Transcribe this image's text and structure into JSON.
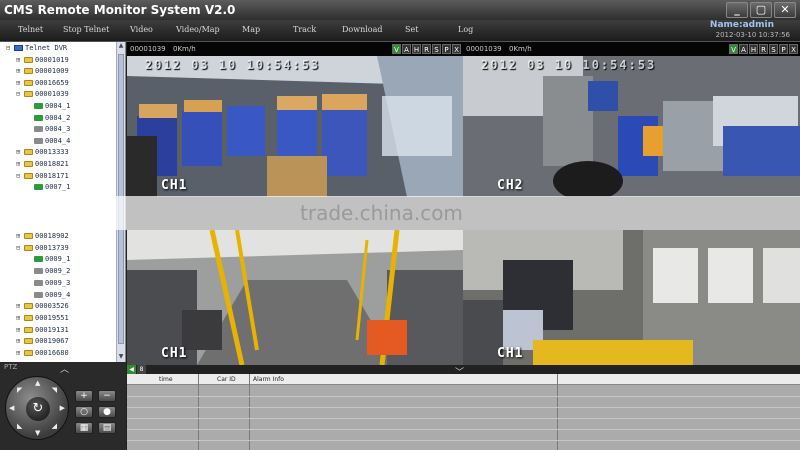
{
  "window": {
    "title": "CMS Remote Monitor System V2.0",
    "controls": [
      "_",
      "▢",
      "✕"
    ]
  },
  "menu": {
    "items": [
      "Telnet",
      "Stop Telnet",
      "Video",
      "Video/Map",
      "Map",
      "Track",
      "Download",
      "Set",
      "Log"
    ]
  },
  "user": {
    "label": "Name:admin",
    "datetime": "2012-03-10 10:37:56"
  },
  "tree": {
    "items": [
      {
        "toggle": "⊟",
        "icon": "root",
        "label": "Telnet DVR"
      },
      {
        "toggle": "⊞",
        "icon": "bus",
        "label": "00001019"
      },
      {
        "toggle": "⊞",
        "icon": "bus",
        "label": "00001009"
      },
      {
        "toggle": "⊞",
        "icon": "bus",
        "label": "00016659"
      },
      {
        "toggle": "⊟",
        "icon": "bus",
        "label": "00001039"
      },
      {
        "toggle": "",
        "icon": "cam",
        "label": "0004_1"
      },
      {
        "toggle": "",
        "icon": "cam",
        "label": "0004_2"
      },
      {
        "toggle": "",
        "icon": "cam-off",
        "label": "0004_3"
      },
      {
        "toggle": "",
        "icon": "cam-off",
        "label": "0004_4"
      },
      {
        "toggle": "⊞",
        "icon": "bus",
        "label": "00013333"
      },
      {
        "toggle": "⊞",
        "icon": "bus",
        "label": "00018821"
      },
      {
        "toggle": "⊟",
        "icon": "bus",
        "label": "00018171"
      },
      {
        "toggle": "",
        "icon": "cam",
        "label": "0007_1"
      },
      {
        "toggle": "⊞",
        "icon": "bus",
        "label": "00018902"
      },
      {
        "toggle": "⊟",
        "icon": "bus",
        "label": "00013739"
      },
      {
        "toggle": "",
        "icon": "cam",
        "label": "0009_1"
      },
      {
        "toggle": "",
        "icon": "cam-off",
        "label": "0009_2"
      },
      {
        "toggle": "",
        "icon": "cam-off",
        "label": "0009_3"
      },
      {
        "toggle": "",
        "icon": "cam-off",
        "label": "0009_4"
      },
      {
        "toggle": "⊞",
        "icon": "bus",
        "label": "00003526"
      },
      {
        "toggle": "⊞",
        "icon": "bus",
        "label": "00019551"
      },
      {
        "toggle": "⊞",
        "icon": "bus",
        "label": "00019131"
      },
      {
        "toggle": "⊞",
        "icon": "bus",
        "label": "00019067"
      },
      {
        "toggle": "⊞",
        "icon": "bus",
        "label": "00016680"
      }
    ]
  },
  "ptz": {
    "label": "PTZ",
    "center_glyph": "↻"
  },
  "videos": [
    {
      "device": "00001039",
      "speed": "0Km/h",
      "buttons": [
        "V",
        "A",
        "H",
        "R",
        "S",
        "P",
        "X"
      ],
      "osd_time": "2012 03 10 10:54:53",
      "channel": "CH1"
    },
    {
      "device": "00001039",
      "speed": "0Km/h",
      "buttons": [
        "V",
        "A",
        "H",
        "R",
        "S",
        "P",
        "X"
      ],
      "osd_time": "2012 03 10 10:54:53",
      "channel": "CH2"
    },
    {
      "device": "",
      "speed": "",
      "buttons": [],
      "osd_time": "",
      "channel": "CH1"
    },
    {
      "device": "",
      "speed": "",
      "buttons": [],
      "osd_time": "",
      "channel": "CH1"
    }
  ],
  "watermark": "trade.china.com",
  "alarm": {
    "tab_numbers": [
      "8"
    ],
    "columns": [
      "time",
      "Car ID",
      "Alarm Info"
    ]
  },
  "colors": {
    "active_button": "#2f8f2f",
    "user_label": "#9fc4ef",
    "tree_bus_icon": "#e8c640",
    "tree_cam_on": "#2c9c3a"
  }
}
